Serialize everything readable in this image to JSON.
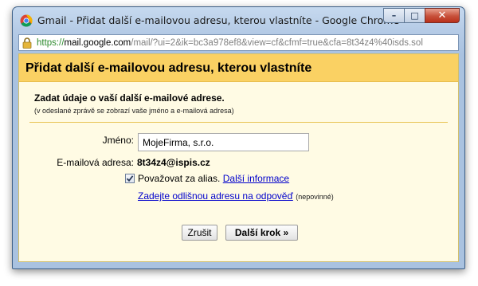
{
  "window": {
    "title": "Gmail - Přidat další e-mailovou adresu, kterou vlastníte - Google Chrome",
    "buttons": {
      "minimize": "–",
      "maximize": "□",
      "close": "✕"
    }
  },
  "address_bar": {
    "scheme": "https://",
    "host": "mail.google.com",
    "path": "/mail/?ui=2&ik=bc3a978ef8&view=cf&cfmf=true&cfa=8t34z4%40isds.sol"
  },
  "dialog": {
    "title": "Přidat další e-mailovou adresu, kterou vlastníte",
    "subtitle": "Zadat údaje o vaší další e-mailové adrese.",
    "note": "(v odeslané zprávě se zobrazí vaše jméno a e-mailová adresa)",
    "name_label": "Jméno:",
    "name_value": "MojeFirma, s.r.o.",
    "email_label": "E-mailová adresa:",
    "email_value": "8t34z4@ispis.cz",
    "alias_checked": true,
    "alias_label": "Považovat za alias.",
    "more_info_link": "Další informace",
    "reply_link": "Zadejte odlišnou adresu na odpověď",
    "reply_optional": "(nepovinné)",
    "cancel_button": "Zrušit",
    "next_button": "Další krok »"
  },
  "icons": {
    "app": "chrome-icon",
    "lock": "lock-icon",
    "check": "checkmark-icon"
  }
}
